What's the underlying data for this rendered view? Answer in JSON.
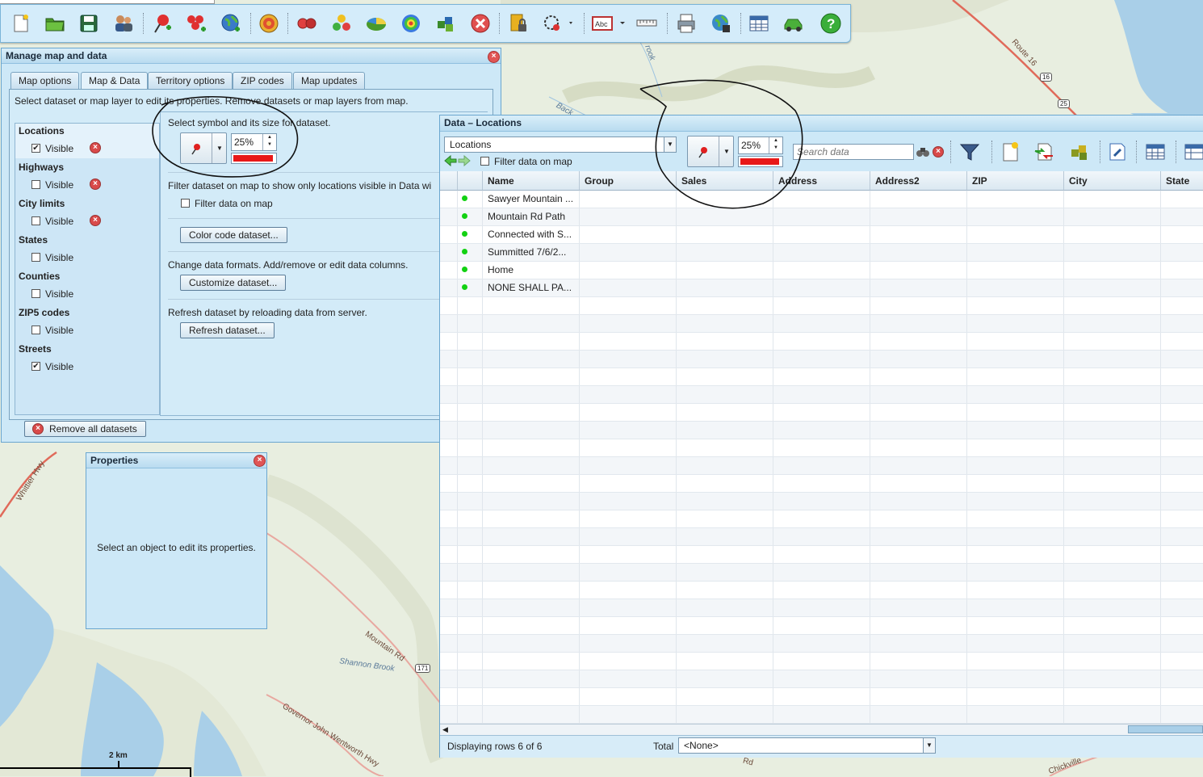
{
  "map": {
    "labels": [
      "Route 16",
      "Whittier Hwy",
      "Mountain Rd",
      "Shannon Brook",
      "Governor John Wentworth Hwy",
      "Back",
      "rook",
      "Rd",
      "Chickville"
    ],
    "shields": [
      "16",
      "25",
      "171"
    ],
    "scale": "2 km",
    "colors": {
      "land": "#e7efe0",
      "water": "#a9cfe8",
      "road": "#e06a5a"
    }
  },
  "toolbar": {
    "icons": [
      "new-document",
      "open-folder",
      "save",
      "users",
      "add-pin",
      "add-pushpins",
      "add-globe-layer",
      "target",
      "dots-red",
      "dots-multi",
      "pie",
      "heat-target",
      "puzzle",
      "close-circle",
      "book-lock",
      "circle-dropdown",
      "label-abc-dropdown",
      "ruler",
      "printer",
      "export-map",
      "calendar-grid",
      "car",
      "help"
    ]
  },
  "manage_panel": {
    "title": "Manage map and data",
    "tabs": [
      "Map options",
      "Map & Data",
      "Territory options",
      "ZIP codes",
      "Map updates"
    ],
    "active_tab": "Map & Data",
    "instruction": "Select dataset or map layer to edit its properties. Remove datasets or map layers from map.",
    "layers": [
      {
        "name": "Locations",
        "visible_label": "Visible",
        "checked": true,
        "removable": true
      },
      {
        "name": "Highways",
        "visible_label": "Visible",
        "checked": false,
        "removable": true
      },
      {
        "name": "City limits",
        "visible_label": "Visible",
        "checked": false,
        "removable": true
      },
      {
        "name": "States",
        "visible_label": "Visible",
        "checked": false,
        "removable": false
      },
      {
        "name": "Counties",
        "visible_label": "Visible",
        "checked": false,
        "removable": false
      },
      {
        "name": "ZIP5 codes",
        "visible_label": "Visible",
        "checked": false,
        "removable": false
      },
      {
        "name": "Streets",
        "visible_label": "Visible",
        "checked": true,
        "removable": false
      }
    ],
    "symbol_label": "Select symbol and its size for dataset.",
    "symbol_size": "25%",
    "symbol_color": "#e81818",
    "filter_desc": "Filter dataset on map to show only locations visible in Data wi",
    "filter_label": "Filter data on map",
    "color_code_button": "Color code dataset...",
    "formats_desc": "Change data formats. Add/remove or edit data columns.",
    "customize_button": "Customize dataset...",
    "refresh_desc": "Refresh dataset by reloading data from server.",
    "refresh_button": "Refresh dataset...",
    "remove_all_button": "Remove all datasets"
  },
  "properties_panel": {
    "title": "Properties",
    "message": "Select an object to edit its properties."
  },
  "data_panel": {
    "title": "Data – Locations",
    "dataset_select": "Locations",
    "filter_label": "Filter data on map",
    "symbol_size": "25%",
    "symbol_color": "#e81818",
    "search_placeholder": "Search data",
    "columns": [
      "Name",
      "Group",
      "Sales",
      "Address",
      "Address2",
      "ZIP",
      "City",
      "State"
    ],
    "rows": [
      {
        "name": "Sawyer Mountain ...",
        "status": "green"
      },
      {
        "name": "Mountain Rd Path",
        "status": "green"
      },
      {
        "name": "Connected with S...",
        "status": "green"
      },
      {
        "name": "Summitted 7/6/2...",
        "status": "green"
      },
      {
        "name": "Home",
        "status": "green"
      },
      {
        "name": "NONE SHALL PA...",
        "status": "green"
      }
    ],
    "status_text": "Displaying rows 6 of 6",
    "total_label": "Total",
    "total_select": "<None>"
  }
}
